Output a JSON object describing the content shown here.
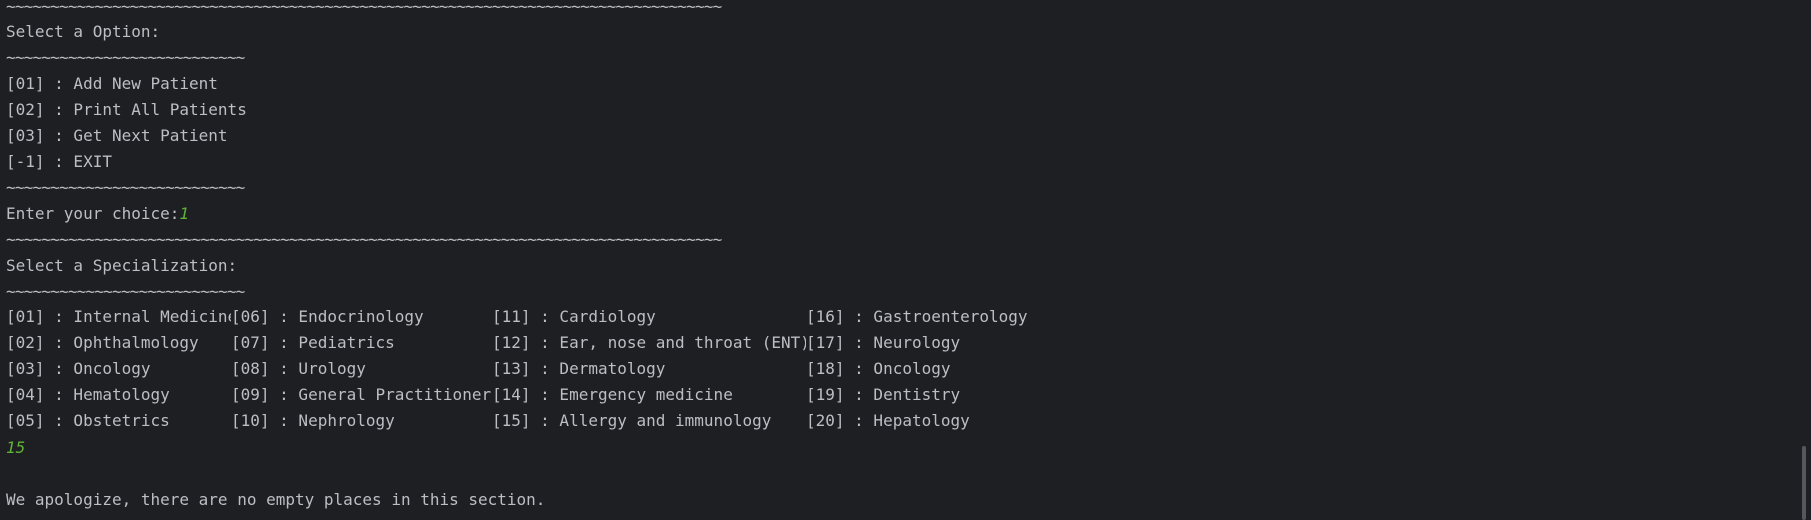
{
  "console": {
    "sep_long": "~~~~~~~~~~~~~~~~~~~~~~~~~~~~~~~~~~~~~~~~~~~~~~~~~~~~~~~~~~~~~~~~~~~~~~~~~~~~~~~~~",
    "sep_short": "~~~~~~~~~~~~~~~~~~~~~~~~~~~",
    "select_option": "Select a Option:",
    "menu": [
      "[01] : Add New Patient",
      "[02] : Print All Patients",
      "[03] : Get Next Patient",
      "[-1] : EXIT"
    ],
    "choice_prompt": "Enter your choice:",
    "choice_input": "1",
    "select_specialization": "Select a Specialization:",
    "specializations": [
      "[01] : Internal Medicine",
      "[06] : Endocrinology",
      "[11] : Cardiology",
      "[16] : Gastroenterology",
      "[02] : Ophthalmology",
      "[07] : Pediatrics",
      "[12] : Ear, nose and throat (ENT)",
      "[17] : Neurology",
      "[03] : Oncology",
      "[08] : Urology",
      "[13] : Dermatology",
      "[18] : Oncology",
      "[04] : Hematology",
      "[09] : General Practitioner",
      "[14] : Emergency medicine",
      "[19] : Dentistry",
      "[05] : Obstetrics",
      "[10] : Nephrology",
      "[15] : Allergy and immunology",
      "[20] : Hepatology"
    ],
    "spec_input": "15",
    "message": "We apologize, there are no empty places in this section."
  },
  "colors": {
    "background": "#1e1f22",
    "text": "#bcbec4",
    "user_input": "#5fb236"
  }
}
